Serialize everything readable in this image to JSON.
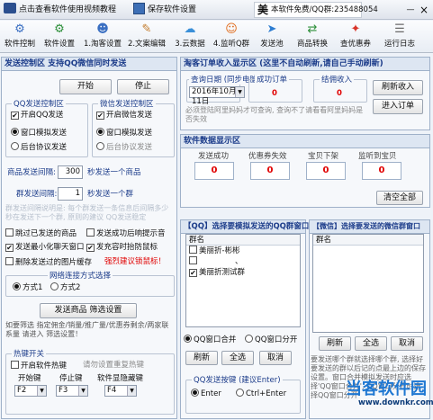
{
  "topbar": {
    "video_link": "点击查看软件使用视频教程",
    "save_settings": "保存软件设置",
    "free_notice": "本软件免费/QQ群:235488054",
    "logo_char": "美",
    "win_min": "—",
    "win_close": "×"
  },
  "toolbar": [
    {
      "label": "软件控制",
      "icon": "gear-icon",
      "glyph": "⚙",
      "color": "#3a6fc2"
    },
    {
      "label": "软件设置",
      "icon": "settings-icon",
      "glyph": "⚙",
      "color": "#2d8f3a"
    },
    {
      "label": "1.淘客设置",
      "icon": "user-icon",
      "glyph": "☻",
      "color": "#3a6fc2"
    },
    {
      "label": "2.文案编辑",
      "icon": "document-icon",
      "glyph": "✎",
      "color": "#c27a2a"
    },
    {
      "label": "3.云数据",
      "icon": "cloud-icon",
      "glyph": "☁",
      "color": "#3a8fd8"
    },
    {
      "label": "4.监听Q群",
      "icon": "group-icon",
      "glyph": "☺",
      "color": "#e06a1a"
    },
    {
      "label": "发送池",
      "icon": "send-icon",
      "glyph": "➤",
      "color": "#2e7dd1"
    },
    {
      "label": "商品转换",
      "icon": "convert-icon",
      "glyph": "⇄",
      "color": "#2d8f3a"
    },
    {
      "label": "查优惠券",
      "icon": "coupon-icon",
      "glyph": "✦",
      "color": "#d8342a"
    },
    {
      "label": "运行日志",
      "icon": "log-icon",
      "glyph": "☰",
      "color": "#6a6a6a"
    }
  ],
  "left": {
    "header": "发送控制区  支持QQ微信同时发送",
    "start": "开始",
    "stop": "停止",
    "qq_group_title": "QQ发送控制区",
    "qq_enable": "开启QQ发送",
    "qq_window_sim": "窗口模拟发送",
    "qq_backend": "后台协议发送",
    "wx_group_title": "微信发送控制区",
    "wx_enable": "开启微信发送",
    "wx_window_sim": "窗口模拟发送",
    "wx_backend": "后台协议发送",
    "item_interval_label": "商品发送间隔:",
    "item_interval_value": "300",
    "item_interval_suffix": "秒发送一个商品",
    "group_interval_label": "群发送间隔:",
    "group_interval_value": "1",
    "group_interval_suffix": "秒发送一个群",
    "faded_note": "群发送间隔说明是: 每个群发送一条信息后间隔多少秒在发送下一个群, 原则的建议 QQ发送稳定",
    "skip_opt1": "跳过已发送的商品",
    "send_success_sound": "发送成功后响提示音",
    "minimize_after": "发送最小化聊天窗口",
    "anti_move_mouse": "发充容时抬防鼠标",
    "delete_images": "删除发送过的图片缓存",
    "strong_warning": "强烈建议锁鼠标！",
    "network_group_title": "网络连接方式选择",
    "mode1": "方式1",
    "mode2": "方式2",
    "filter_button": "发送商品 筛选设置",
    "filter_note": "如要筛选  指定佣金/销量/推广量/优惠券剩余/两家联系量  请进入  筛选设置！",
    "hotkey_title": "热键开关",
    "hotkey_enable": "开启软件热键",
    "hotkey_reset_note": "请勿设置重复热键",
    "hk_start_label": "开始键",
    "hk_start_value": "F2",
    "hk_stop_label": "停止键",
    "hk_stop_value": "F3",
    "hk_hide_label": "软件显隐藏键",
    "hk_hide_value": "F4"
  },
  "order": {
    "header": "淘客订单收入显示区 (这里不自动刷新,请自己手动刷新)",
    "query_date_label": "查询日期 (同步电脑)",
    "query_date_value": "2016年10月11日",
    "success_orders_label": "成功订单",
    "success_orders_value": "0",
    "settled_income_label": "结佣收入",
    "settled_income_value": "0",
    "refresh_income": "刷新收入",
    "enter_orders": "进入订单",
    "note": "必须登陆阿里妈妈才可查询, 查询不了请看看阿里妈妈是否失效"
  },
  "stats": {
    "header": "软件数据显示区",
    "items": [
      {
        "label": "发送成功",
        "value": "0"
      },
      {
        "label": "优惠券失效",
        "value": "0"
      },
      {
        "label": "宝贝下架",
        "value": "0"
      },
      {
        "label": "监听到宝贝",
        "value": "0"
      }
    ],
    "clear_all": "清空全部"
  },
  "qq_groups": {
    "header": "【QQ】选择要模拟发送的QQ群窗口",
    "column": "群名",
    "rows": [
      {
        "checked": false,
        "name": "美丽折-彬彬"
      },
      {
        "checked": false,
        "name": "、"
      },
      {
        "checked": true,
        "name": "美丽折测试群"
      }
    ],
    "merge": "QQ窗口合并",
    "split": "QQ窗口分开",
    "refresh": "刷新",
    "select_all": "全选",
    "cancel": "取消",
    "send_key_title": "QQ发送按键 (建议Enter)",
    "key_enter": "Enter",
    "key_ctrl_enter": "Ctrl+Enter"
  },
  "wx_groups": {
    "header": "【微信】选择要发送的微信群窗口",
    "column": "群名",
    "refresh": "刷新",
    "select_all": "全选",
    "cancel": "取消",
    "note": "要发送哪个群就选择哪个群, 选择好要发送的群以后记的点最上边的保存设置。窗口合并模拟发送时应选择'QQ窗口合并', QQ窗口分开时选择QQ窗口分开"
  },
  "watermark": {
    "main": "当客软件园",
    "url": "www.downkr.com"
  }
}
